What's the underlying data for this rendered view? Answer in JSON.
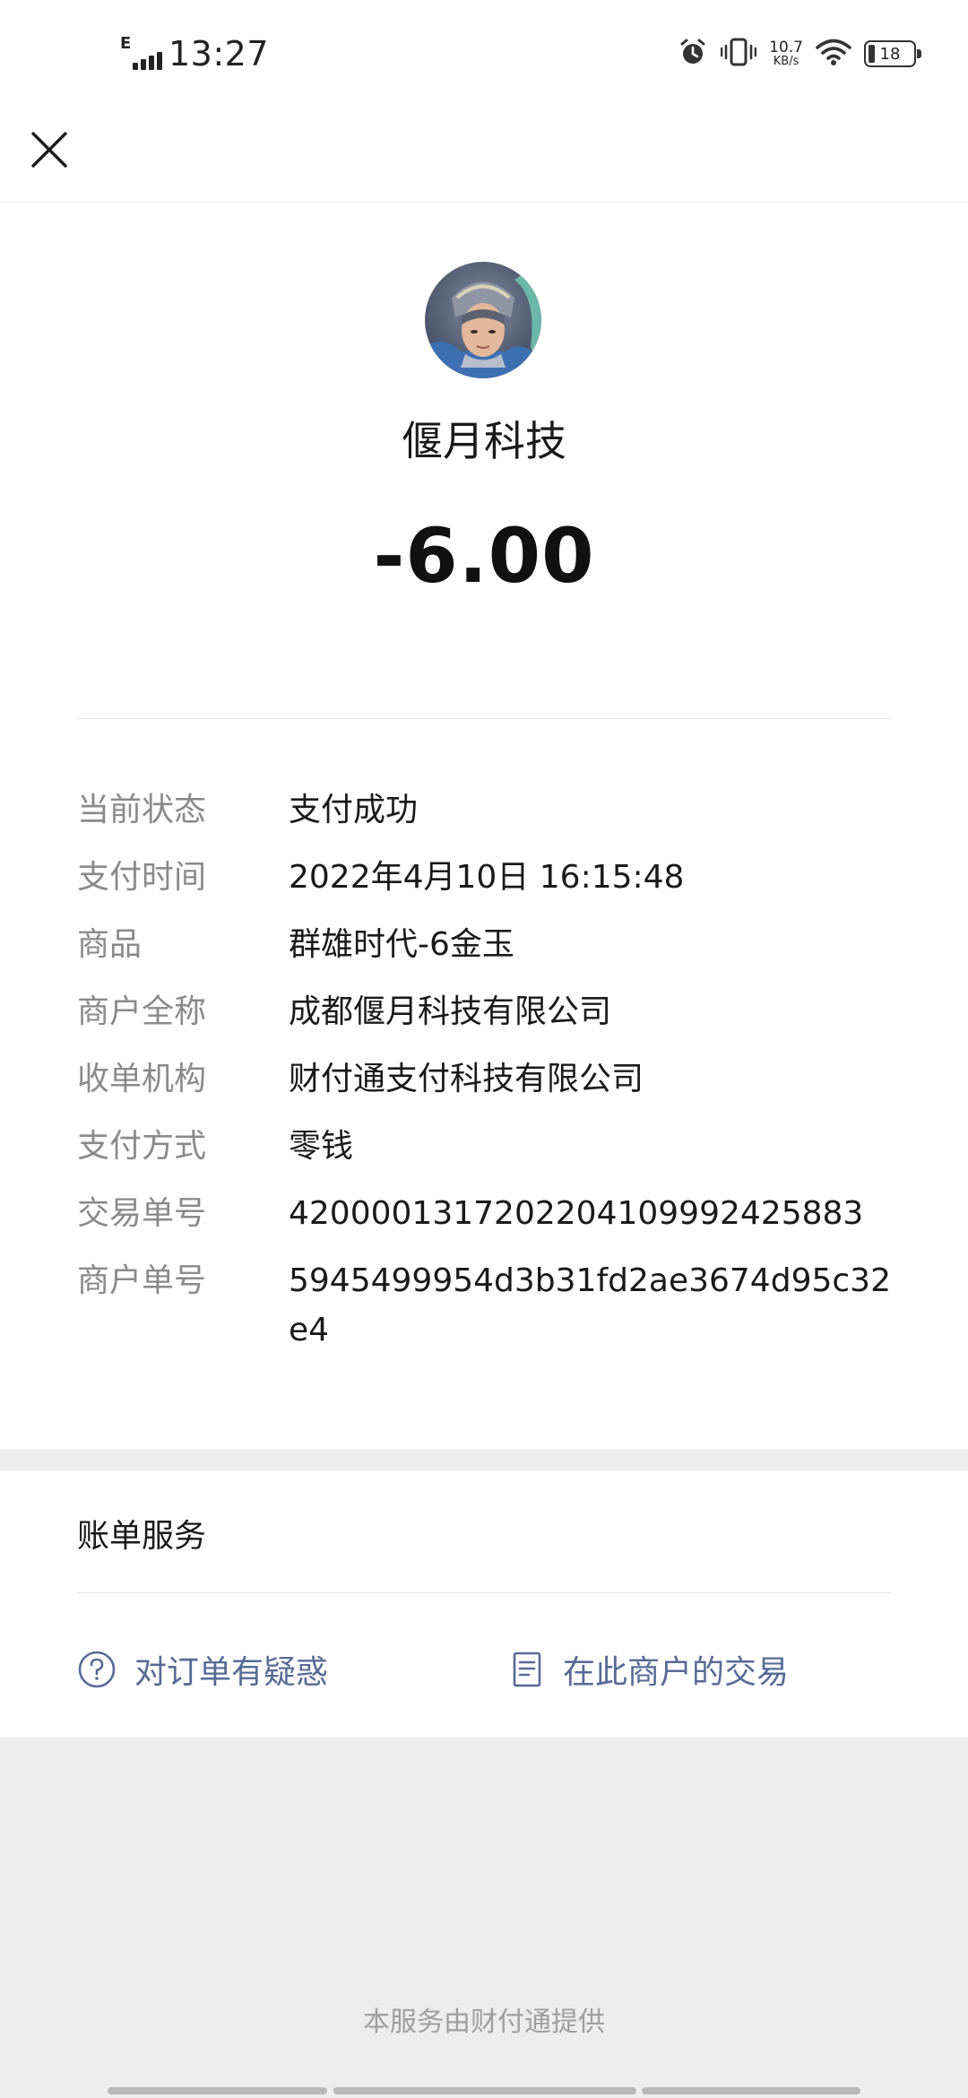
{
  "status_bar": {
    "network_type": "E",
    "time": "13:27",
    "net_speed_value": "10.7",
    "net_speed_unit": "KB/s",
    "battery_level": "18"
  },
  "merchant": {
    "name": "偃月科技"
  },
  "amount": "-6.00",
  "details": [
    {
      "label": "当前状态",
      "value": "支付成功"
    },
    {
      "label": "支付时间",
      "value": "2022年4月10日 16:15:48"
    },
    {
      "label": "商品",
      "value": "群雄时代-6金玉"
    },
    {
      "label": "商户全称",
      "value": "成都偃月科技有限公司"
    },
    {
      "label": "收单机构",
      "value": "财付通支付科技有限公司"
    },
    {
      "label": "支付方式",
      "value": "零钱"
    },
    {
      "label": "交易单号",
      "value": "4200001317202204109992425883"
    },
    {
      "label": "商户单号",
      "value": "5945499954d3b31fd2ae3674d95c32e4"
    }
  ],
  "services": {
    "title": "账单服务",
    "query_order": "对订单有疑惑",
    "merchant_transactions": "在此商户的交易"
  },
  "footer": "本服务由财付通提供",
  "icons": {
    "close": "close-icon",
    "question": "question-circle-icon",
    "document": "document-list-icon",
    "alarm": "alarm-icon",
    "vibrate": "vibrate-icon",
    "wifi": "wifi-icon"
  },
  "colors": {
    "link": "#576b95",
    "label": "#8a8a8a",
    "background": "#ededed"
  }
}
